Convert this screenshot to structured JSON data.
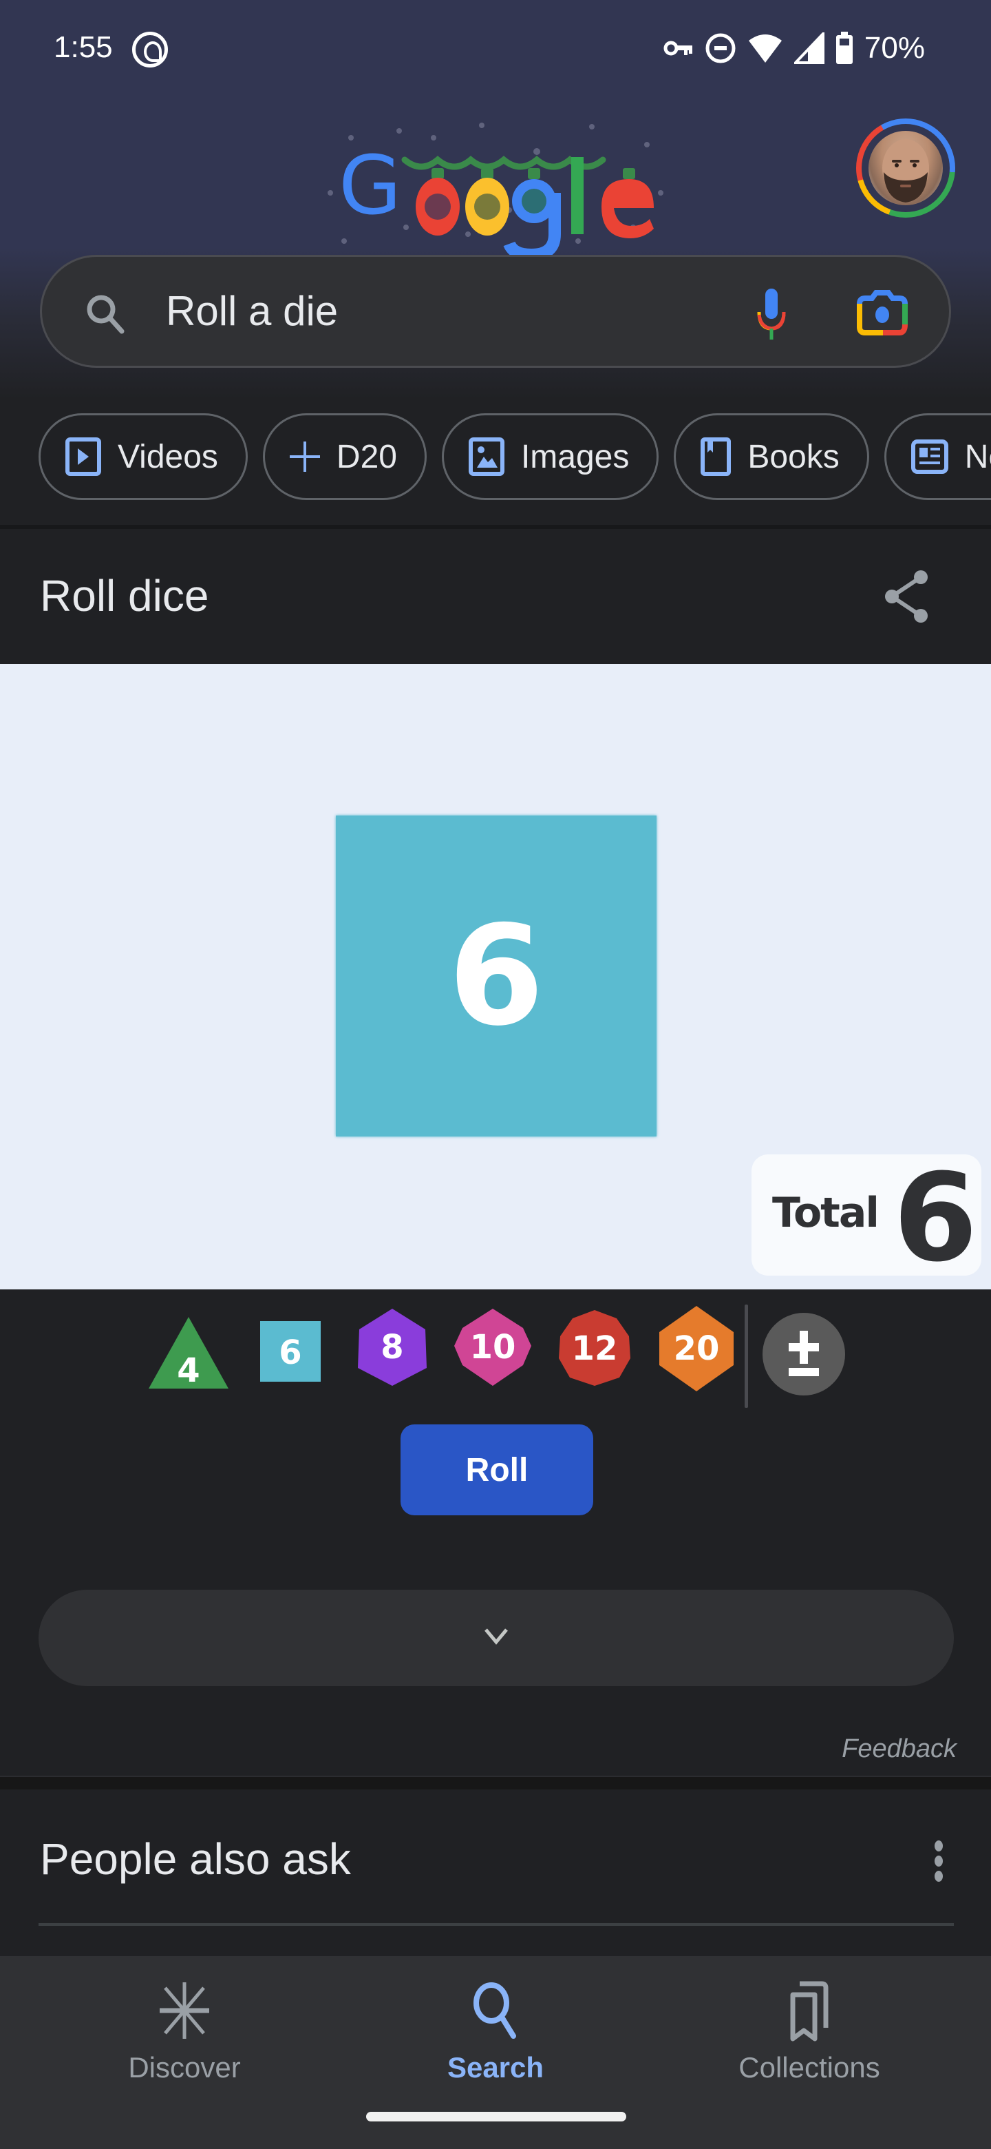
{
  "status_bar": {
    "time": "1:55",
    "battery_percent": "70%",
    "icons": [
      "app-notification-icon",
      "vpn-key-icon",
      "do-not-disturb-icon",
      "wifi-icon",
      "cell-signal-icon",
      "battery-icon"
    ]
  },
  "header": {
    "logo_text": "Google",
    "doodle_theme": "holiday-lights",
    "search_query": "Roll a die",
    "icons": [
      "search-icon",
      "mic-icon",
      "lens-icon"
    ]
  },
  "chips": [
    {
      "label": "Videos",
      "icon": "video-icon"
    },
    {
      "label": "D20",
      "icon": "plus-icon"
    },
    {
      "label": "Images",
      "icon": "image-icon"
    },
    {
      "label": "Books",
      "icon": "book-icon"
    },
    {
      "label": "News",
      "icon": "news-icon"
    }
  ],
  "dice_card": {
    "title": "Roll dice",
    "rolled_die": {
      "sides": 6,
      "value": "6",
      "color": "#5bbbd0"
    },
    "total_label": "Total",
    "total_value": "6",
    "dice_options": [
      {
        "label": "4",
        "sides": 4,
        "shape": "triangle",
        "color": "#3e9b4f"
      },
      {
        "label": "6",
        "sides": 6,
        "shape": "square",
        "color": "#5bbbd0"
      },
      {
        "label": "8",
        "sides": 8,
        "shape": "hexagon",
        "color": "#8a3ddb"
      },
      {
        "label": "10",
        "sides": 10,
        "shape": "diamond",
        "color": "#d04595"
      },
      {
        "label": "12",
        "sides": 12,
        "shape": "decagon",
        "color": "#c93c31"
      },
      {
        "label": "20",
        "sides": 20,
        "shape": "hexagon-tall",
        "color": "#e57b2c"
      }
    ],
    "modifier_label": "±",
    "roll_button": "Roll",
    "feedback": "Feedback"
  },
  "people_also_ask": {
    "title": "People also ask"
  },
  "bottom_nav": {
    "items": [
      {
        "label": "Discover",
        "icon": "discover-icon",
        "active": false
      },
      {
        "label": "Search",
        "icon": "search-icon",
        "active": true
      },
      {
        "label": "Collections",
        "icon": "collections-icon",
        "active": false
      }
    ]
  },
  "colors": {
    "accent": "#8ab4f8",
    "roll_button": "#2a56c6",
    "header_bg": "#323652",
    "page_bg": "#202124",
    "stage_bg": "#e8eef9"
  }
}
